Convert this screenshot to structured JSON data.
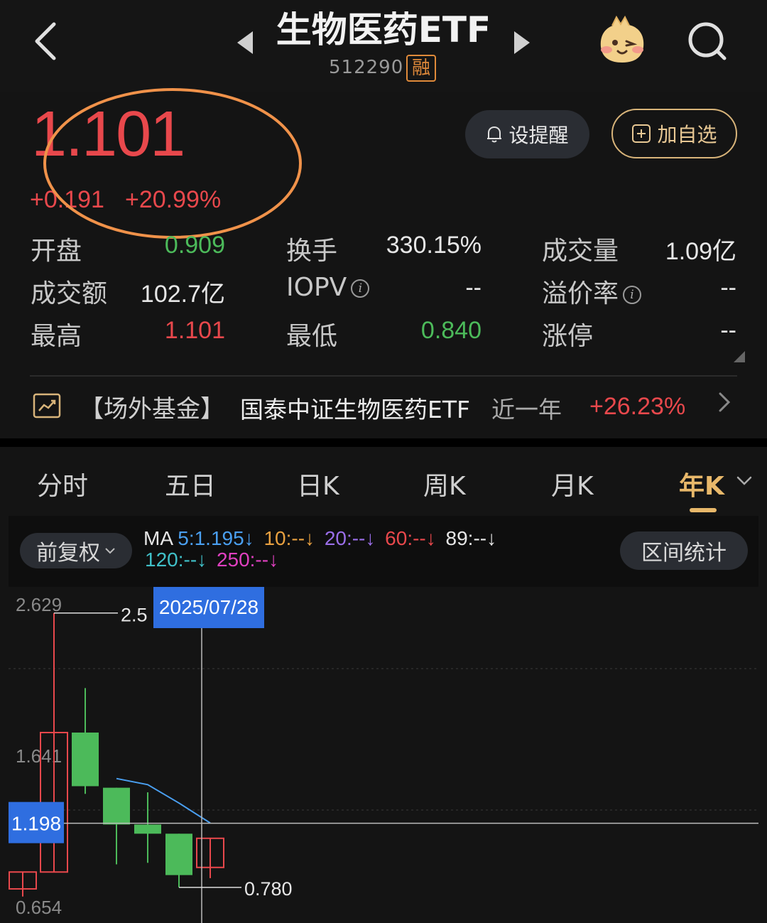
{
  "header": {
    "title": "生物医药ETF",
    "code": "512290",
    "badge": "融"
  },
  "quote": {
    "price": "1.101",
    "change": "+0.191",
    "change_pct": "+20.99%",
    "color_up": "#e8484c",
    "color_down": "#4cba5a"
  },
  "actions": {
    "alert_label": "设提醒",
    "watch_label": "加自选"
  },
  "stats": [
    {
      "label": "开盘",
      "value": "0.909",
      "color": "#4cba5a",
      "info": false
    },
    {
      "label": "换手",
      "value": "330.15%",
      "color": "#e6e6e6",
      "info": false
    },
    {
      "label": "成交量",
      "value": "1.09亿",
      "color": "#e6e6e6",
      "info": false
    },
    {
      "label": "成交额",
      "value": "102.7亿",
      "color": "#e6e6e6",
      "info": false
    },
    {
      "label": "IOPV",
      "value": "--",
      "color": "#e6e6e6",
      "info": true
    },
    {
      "label": "溢价率",
      "value": "--",
      "color": "#e6e6e6",
      "info": true
    },
    {
      "label": "最高",
      "value": "1.101",
      "color": "#e8484c",
      "info": false
    },
    {
      "label": "最低",
      "value": "0.840",
      "color": "#4cba5a",
      "info": false
    },
    {
      "label": "涨停",
      "value": "--",
      "color": "#e6e6e6",
      "info": false
    }
  ],
  "fund": {
    "tag": "【场外基金】",
    "name": "国泰中证生物医药ETF",
    "period": "近一年",
    "return": "+26.23%"
  },
  "tabs": [
    {
      "label": "分时",
      "active": false
    },
    {
      "label": "五日",
      "active": false
    },
    {
      "label": "日K",
      "active": false
    },
    {
      "label": "周K",
      "active": false
    },
    {
      "label": "月K",
      "active": false
    },
    {
      "label": "年K",
      "active": true
    }
  ],
  "toolbar": {
    "adjust_label": "前复权",
    "range_label": "区间统计",
    "ma_prefix": "MA",
    "ma_items": [
      {
        "text": "5:1.195",
        "color": "#4a9ff0"
      },
      {
        "text": "10:--",
        "color": "#e8a040"
      },
      {
        "text": "20:--",
        "color": "#9a6ee8"
      },
      {
        "text": "60:--",
        "color": "#e8484c"
      },
      {
        "text": "89:--",
        "color": "#e6e6e6"
      },
      {
        "text": "120:--",
        "color": "#40c0c8"
      },
      {
        "text": "250:--",
        "color": "#e040c0"
      }
    ]
  },
  "chart_data": {
    "type": "candlestick",
    "y_axis_labels": [
      "2.629",
      "1.641",
      "0.654"
    ],
    "ylim": [
      0.654,
      2.629
    ],
    "high_label": "2.5",
    "low_label": "0.780",
    "crosshair_date": "2025/07/28",
    "crosshair_price": "1.198",
    "candles": [
      {
        "open": 0.88,
        "close": 0.77,
        "high": 0.88,
        "low": 0.72,
        "color": "red"
      },
      {
        "open": 0.88,
        "close": 1.79,
        "high": 2.57,
        "low": 0.88,
        "color": "red"
      },
      {
        "open": 1.79,
        "close": 1.44,
        "high": 2.08,
        "low": 1.39,
        "color": "green"
      },
      {
        "open": 1.43,
        "close": 1.19,
        "high": 1.43,
        "low": 0.93,
        "color": "green"
      },
      {
        "open": 1.19,
        "close": 1.13,
        "high": 1.4,
        "low": 0.94,
        "color": "green"
      },
      {
        "open": 1.13,
        "close": 0.86,
        "high": 1.13,
        "low": 0.78,
        "color": "green"
      },
      {
        "open": 0.91,
        "close": 1.1,
        "high": 1.1,
        "low": 0.84,
        "color": "red"
      }
    ],
    "ma5": [
      null,
      null,
      null,
      1.49,
      1.45,
      1.33,
      1.2
    ]
  }
}
